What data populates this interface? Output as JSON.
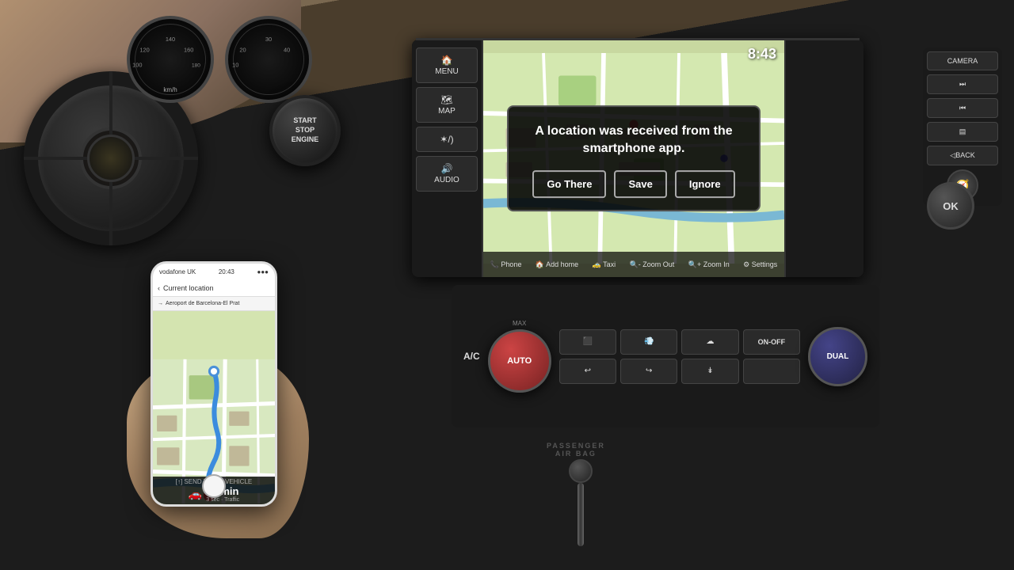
{
  "background": {
    "color": "#1a1208"
  },
  "infotainment": {
    "time": "8:43",
    "notification": {
      "message": "A location was received from the smartphone app.",
      "button_go_there": "Go There",
      "button_save": "Save",
      "button_ignore": "Ignore"
    },
    "left_controls": [
      {
        "label": "MENU",
        "icon": "🏠"
      },
      {
        "label": "MAP",
        "icon": "🗺"
      },
      {
        "label": "✶/)",
        "icon": ""
      },
      {
        "label": "AUDIO",
        "icon": "🔊"
      }
    ],
    "toolbar_items": [
      "Phone",
      "Add Home",
      "Taxi",
      "Zoom Out",
      "Zoom In",
      "Settings"
    ]
  },
  "right_panel": {
    "camera_label": "CAMERA",
    "btn1": "⏭",
    "btn2": "⏮",
    "btn3": "▤",
    "back_label": "◁BACK"
  },
  "ok_button": "OK",
  "start_stop": {
    "line1": "START",
    "line2": "STOP",
    "line3": "ENGINE"
  },
  "climate": {
    "ac_label": "A/C",
    "auto_label": "AUTO",
    "on_off_label": "ON-OFF",
    "dual_label": "DUAL",
    "max_label": "MAX"
  },
  "airbag": {
    "line1": "PASSENGER",
    "line2": "AIR BAG"
  },
  "phone": {
    "status_carrier": "vodafone UK",
    "time": "20:43",
    "signal": "●●●",
    "origin": "Current location",
    "destination": "Aeroport de Barcelona-El Prat",
    "send_label": "[↑] SEND TO MY VEHICLE",
    "eta_minutes": "19 min",
    "eta_traffic": "3 sec · Traffic"
  }
}
